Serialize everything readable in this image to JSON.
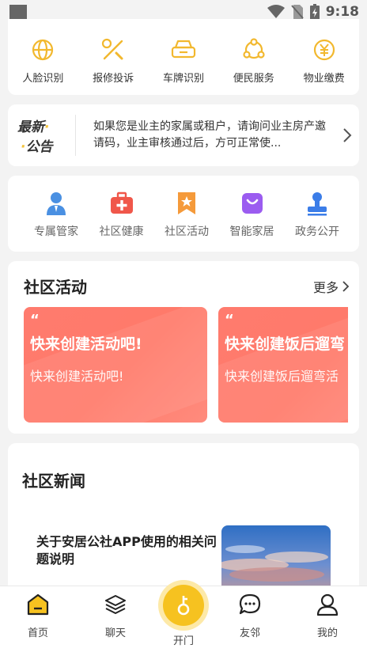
{
  "status_bar": {
    "time": "9:18"
  },
  "quick_services": [
    {
      "label": "人脸识别",
      "icon": "face-recognition-icon"
    },
    {
      "label": "报修投诉",
      "icon": "repair-tools-icon"
    },
    {
      "label": "车牌识别",
      "icon": "car-icon"
    },
    {
      "label": "便民服务",
      "icon": "convenience-service-icon"
    },
    {
      "label": "物业缴费",
      "icon": "yen-payment-icon"
    }
  ],
  "notice": {
    "logo_line1": "最新",
    "logo_line2": "公告",
    "text": "如果您是业主的家属或租户，请询问业主房产邀请码，业主审核通过后，方可正常使..."
  },
  "community_services": [
    {
      "label": "专属管家",
      "icon": "butler-icon",
      "color": "#4a90e2"
    },
    {
      "label": "社区健康",
      "icon": "medical-kit-icon",
      "color": "#f0574a"
    },
    {
      "label": "社区活动",
      "icon": "activity-bookmark-icon",
      "color": "#f59a3a"
    },
    {
      "label": "智能家居",
      "icon": "smart-home-bag-icon",
      "color": "#9b5cf0"
    },
    {
      "label": "政务公开",
      "icon": "government-stamp-icon",
      "color": "#3b7de8"
    }
  ],
  "activities": {
    "title": "社区活动",
    "more_label": "更多",
    "items": [
      {
        "quote": "“",
        "title": "快来创建活动吧!",
        "subtitle": "快来创建活动吧!"
      },
      {
        "quote": "“",
        "title": "快来创建饭后遛弯",
        "subtitle": "快来创建饭后遛弯活"
      }
    ]
  },
  "news": {
    "title": "社区新闻",
    "items": [
      {
        "title": "关于安居公社APP使用的相关问题说明"
      }
    ]
  },
  "tabbar": {
    "items": [
      {
        "label": "首页",
        "icon": "home-icon"
      },
      {
        "label": "聊天",
        "icon": "layers-icon"
      },
      {
        "label": "开门",
        "icon": "key-icon"
      },
      {
        "label": "友邻",
        "icon": "chat-bubble-icon"
      },
      {
        "label": "我的",
        "icon": "user-icon"
      }
    ]
  },
  "colors": {
    "accent_yellow": "#f6c220",
    "activity_red": "#ff7b6e"
  }
}
